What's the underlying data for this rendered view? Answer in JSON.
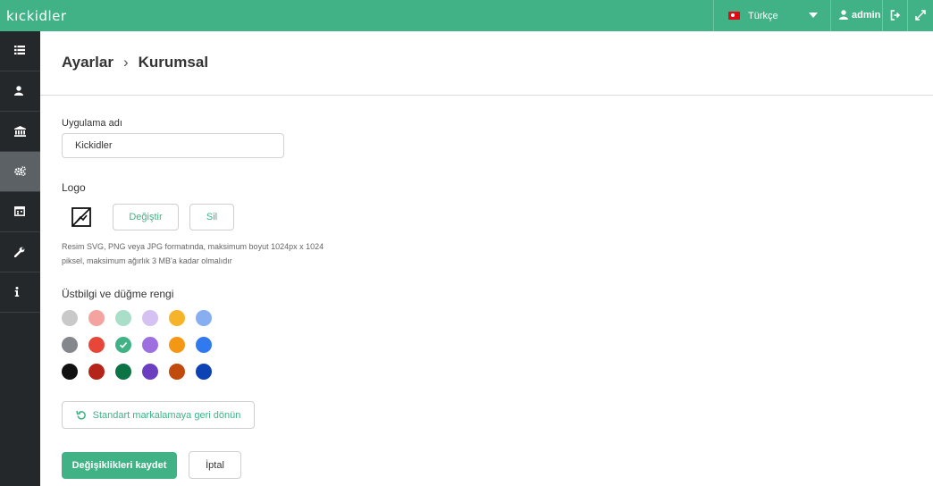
{
  "app": {
    "logo_text": "kıckidler"
  },
  "topbar": {
    "language": "Türkçe",
    "user": "admin"
  },
  "breadcrumb": {
    "parent": "Ayarlar",
    "current": "Kurumsal"
  },
  "form": {
    "app_name_label": "Uygulama adı",
    "app_name_value": "Kickidler",
    "logo_label": "Logo",
    "change_label": "Değiştir",
    "delete_label": "Sil",
    "logo_help_line1": "Resim SVG, PNG veya JPG formatında, maksimum boyut 1024px x 1024",
    "logo_help_line2": "piksel, maksimum ağırlık 3 MB'a kadar olmalıdır",
    "color_label": "Üstbilgi ve düğme rengi",
    "colors": [
      [
        "#c9c9c9",
        "#f4a3a0",
        "#a9dfc8",
        "#d6c1f3",
        "#f6b42a",
        "#86aef1"
      ],
      [
        "#84878c",
        "#e9463a",
        "#40b286",
        "#9d6fe0",
        "#f49714",
        "#3079ef"
      ],
      [
        "#111111",
        "#b42419",
        "#0c7346",
        "#6c3fc1",
        "#c04b0d",
        "#0c42b4"
      ]
    ],
    "selected_color": "#40b286",
    "reset_label": "Standart markalamaya geri dönün",
    "save_label": "Değişiklikleri kaydet",
    "cancel_label": "İptal"
  }
}
